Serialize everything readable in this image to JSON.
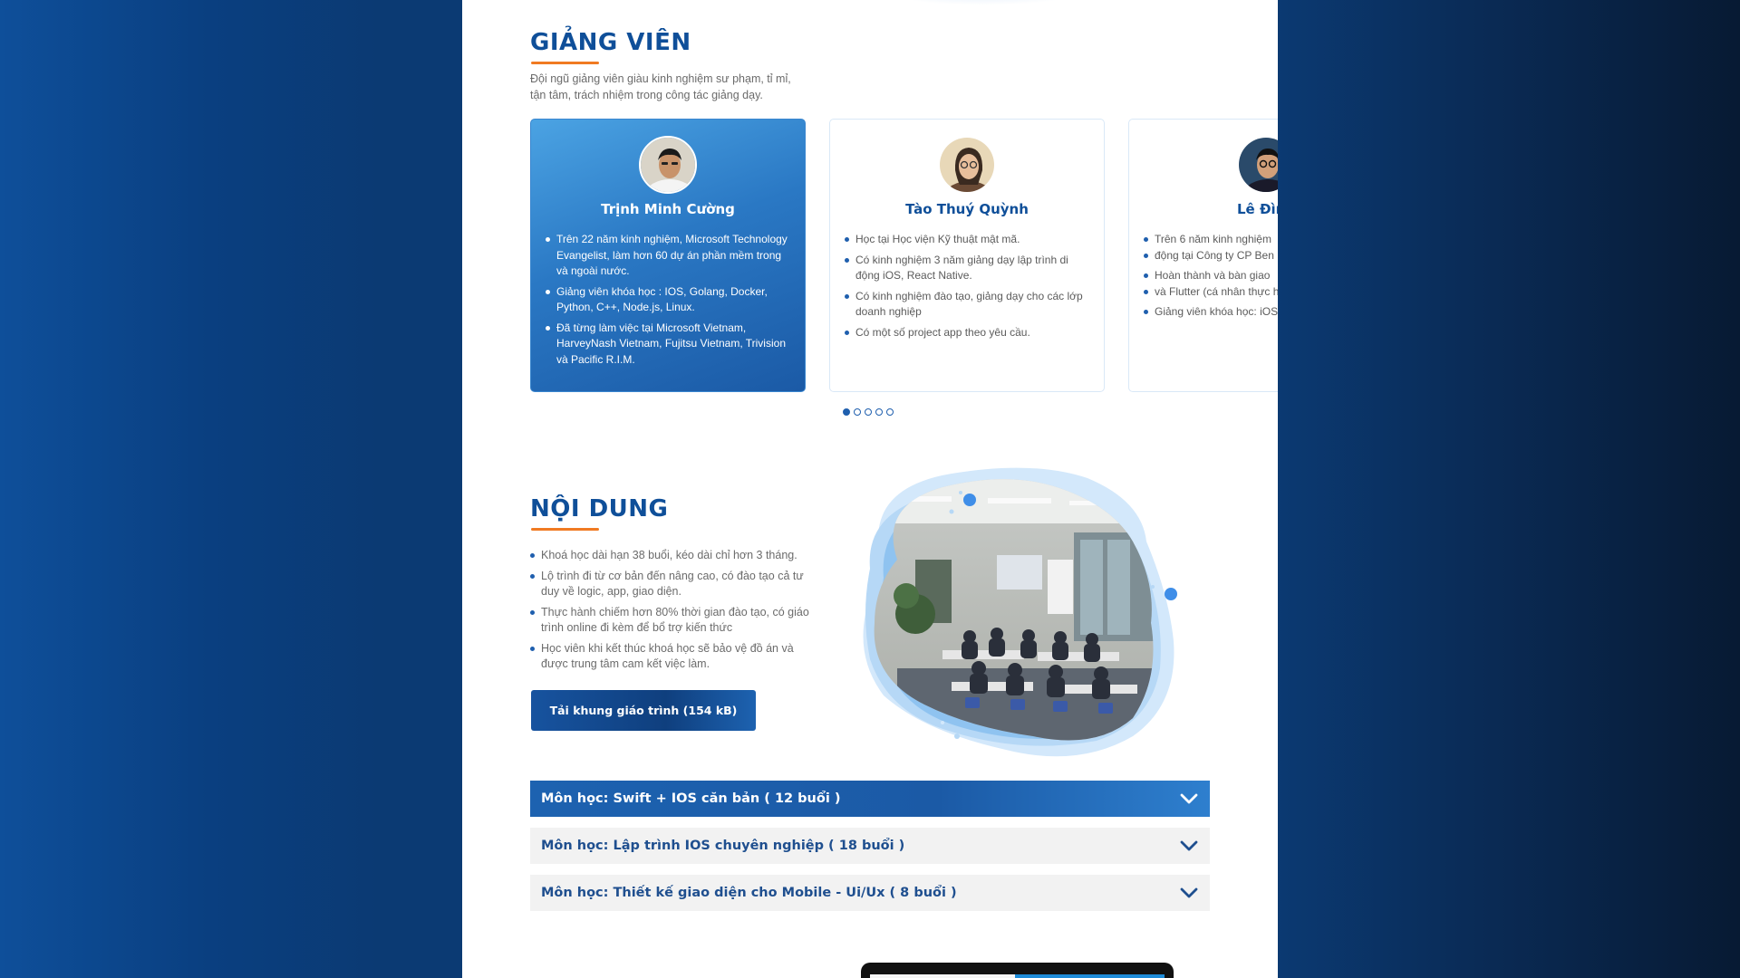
{
  "instructors": {
    "title": "GIẢNG VIÊN",
    "description": "Đội ngũ giảng viên giàu kinh nghiệm sư phạm, tỉ mỉ, tận tâm, trách nhiệm trong công tác giảng dạy.",
    "cards": [
      {
        "name": "Trịnh Minh Cường",
        "points": [
          "Trên 22 năm kinh nghiệm, Microsoft Technology Evangelist, làm hơn 60 dự án phần mềm trong và ngoài nước.",
          "Giảng viên khóa học : IOS, Golang, Docker, Python, C++, Node.js, Linux.",
          "Đã từng làm việc tại Microsoft Vietnam, HarveyNash Vietnam, Fujitsu Vietnam, Trivision và Pacific R.I.M."
        ]
      },
      {
        "name": "Tào Thuý Quỳnh",
        "points": [
          "Học tại Học viện Kỹ thuật mật mã.",
          "Có kinh nghiệm 3 năm giảng dạy lập trình di động iOS, React Native.",
          "Có kinh nghiệm đào tạo, giảng dạy cho các lớp doanh nghiệp",
          "Có một số project app theo yêu cầu."
        ]
      },
      {
        "name": "Lê Đình",
        "points": [
          "Trên 6 năm kinh nghiệm",
          "động tại Công ty CP Ben",
          "Hoàn thành và bàn giao",
          "và Flutter (cá nhân thực h",
          "Giảng viên khóa học: iOS"
        ]
      }
    ],
    "pagination": {
      "total": 5,
      "active": 0
    }
  },
  "content": {
    "title": "NỘI DUNG",
    "points": [
      "Khoá học dài hạn 38 buổi, kéo dài chỉ hơn 3 tháng.",
      "Lộ trình đi từ cơ bản đến nâng cao, có đào tạo cả tư duy về logic, app, giao diện.",
      "Thực hành chiếm hơn 80% thời gian đào tạo, có giáo trình online đi kèm để bổ trợ kiến thức",
      "Học viên khi kết thúc khoá học sẽ bảo vệ đồ án và được trung tâm cam kết việc làm."
    ],
    "download_label": "Tải khung giáo trình (154 kB)"
  },
  "modules": [
    {
      "label": "Môn học: Swift + IOS căn bản ( 12 buổi )",
      "state": "open"
    },
    {
      "label": "Môn học: Lập trình IOS chuyên nghiệp ( 18 buổi )",
      "state": "closed"
    },
    {
      "label": "Môn học: Thiết kế giao diện cho Mobile - Ui/Ux ( 8 buổi )",
      "state": "closed"
    }
  ],
  "colors": {
    "brand_blue": "#0f4f99",
    "accent_orange": "#f07a22",
    "page_background": "#0b3a73"
  },
  "icons": {
    "accordion_toggle": "chevron-down-icon",
    "list_marker": "bullet-icon"
  }
}
